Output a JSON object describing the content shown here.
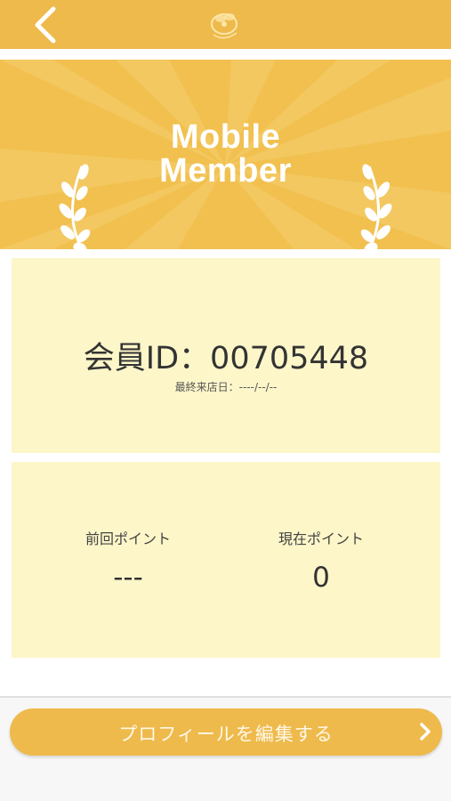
{
  "header": {
    "back_icon": "chevron-left-icon",
    "logo_icon": "bee-logo-icon"
  },
  "banner": {
    "title_line1": "Mobile",
    "title_line2": "Member",
    "decoration_icon": "laurel-branch-icon"
  },
  "member": {
    "id_text": "会員ID：00705448",
    "last_visit_text": "最終来店日：----/--/--"
  },
  "points": {
    "previous_label": "前回ポイント",
    "previous_value": "---",
    "current_label": "現在ポイント",
    "current_value": "0"
  },
  "actions": {
    "edit_profile_label": "プロフィールを編集する",
    "edit_profile_icon": "chevron-right-icon"
  },
  "colors": {
    "primary": "#eeba4c",
    "banner": "#f1c04f",
    "panel": "#fdf6c9"
  }
}
